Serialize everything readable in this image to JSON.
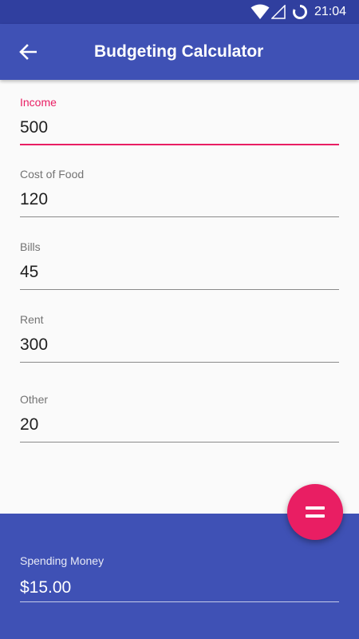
{
  "status_bar": {
    "time": "21:04",
    "icons": [
      "wifi-icon",
      "cell-signal-icon",
      "battery-loading-icon"
    ]
  },
  "app_bar": {
    "title": "Budgeting Calculator",
    "back_icon": "arrow-back-icon"
  },
  "colors": {
    "primary": "#3f51b5",
    "primary_dark": "#303f9f",
    "accent": "#e91e63",
    "background": "#fafafa"
  },
  "form": {
    "income": {
      "label": "Income",
      "value": "500"
    },
    "food": {
      "label": "Cost of Food",
      "value": "120"
    },
    "bills": {
      "label": "Bills",
      "value": "45"
    },
    "rent": {
      "label": "Rent",
      "value": "300"
    },
    "other": {
      "label": "Other",
      "value": "20"
    }
  },
  "fab": {
    "icon": "equals-icon"
  },
  "result": {
    "label": "Spending Money",
    "value": "$15.00"
  }
}
